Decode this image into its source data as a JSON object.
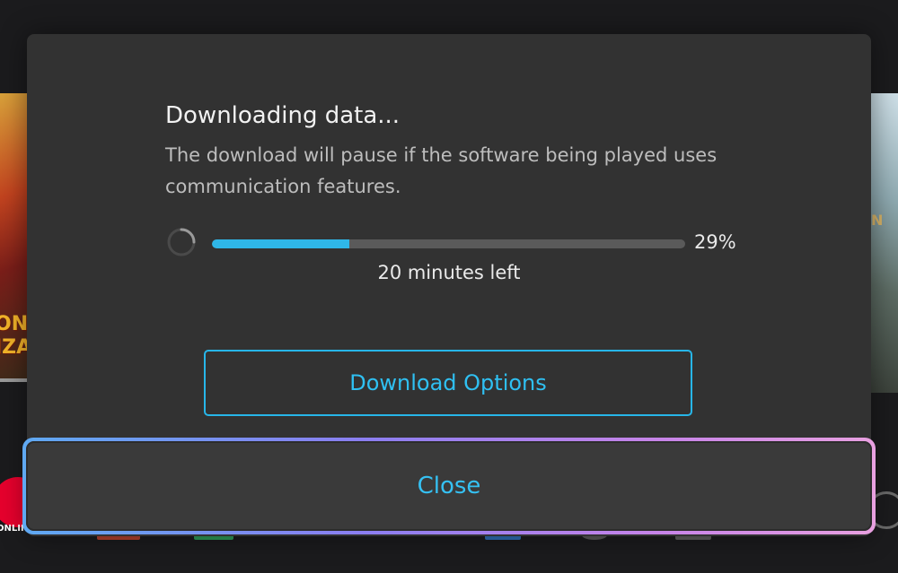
{
  "background": {
    "left_tile_text": "ONG\nIZA",
    "right_tile_text": "N",
    "dock_online_label": "ONLINE"
  },
  "dialog": {
    "title": "Downloading data...",
    "description": "The download will pause if the software being played uses communication features.",
    "progress": {
      "percent_label": "29%",
      "fraction": 0.29,
      "time_left": "20 minutes left",
      "fill_color": "#2fb7e8"
    },
    "options_button_label": "Download Options",
    "close_button_label": "Close"
  },
  "colors": {
    "accent": "#2fc0f2",
    "dialog_bg": "#323232"
  }
}
